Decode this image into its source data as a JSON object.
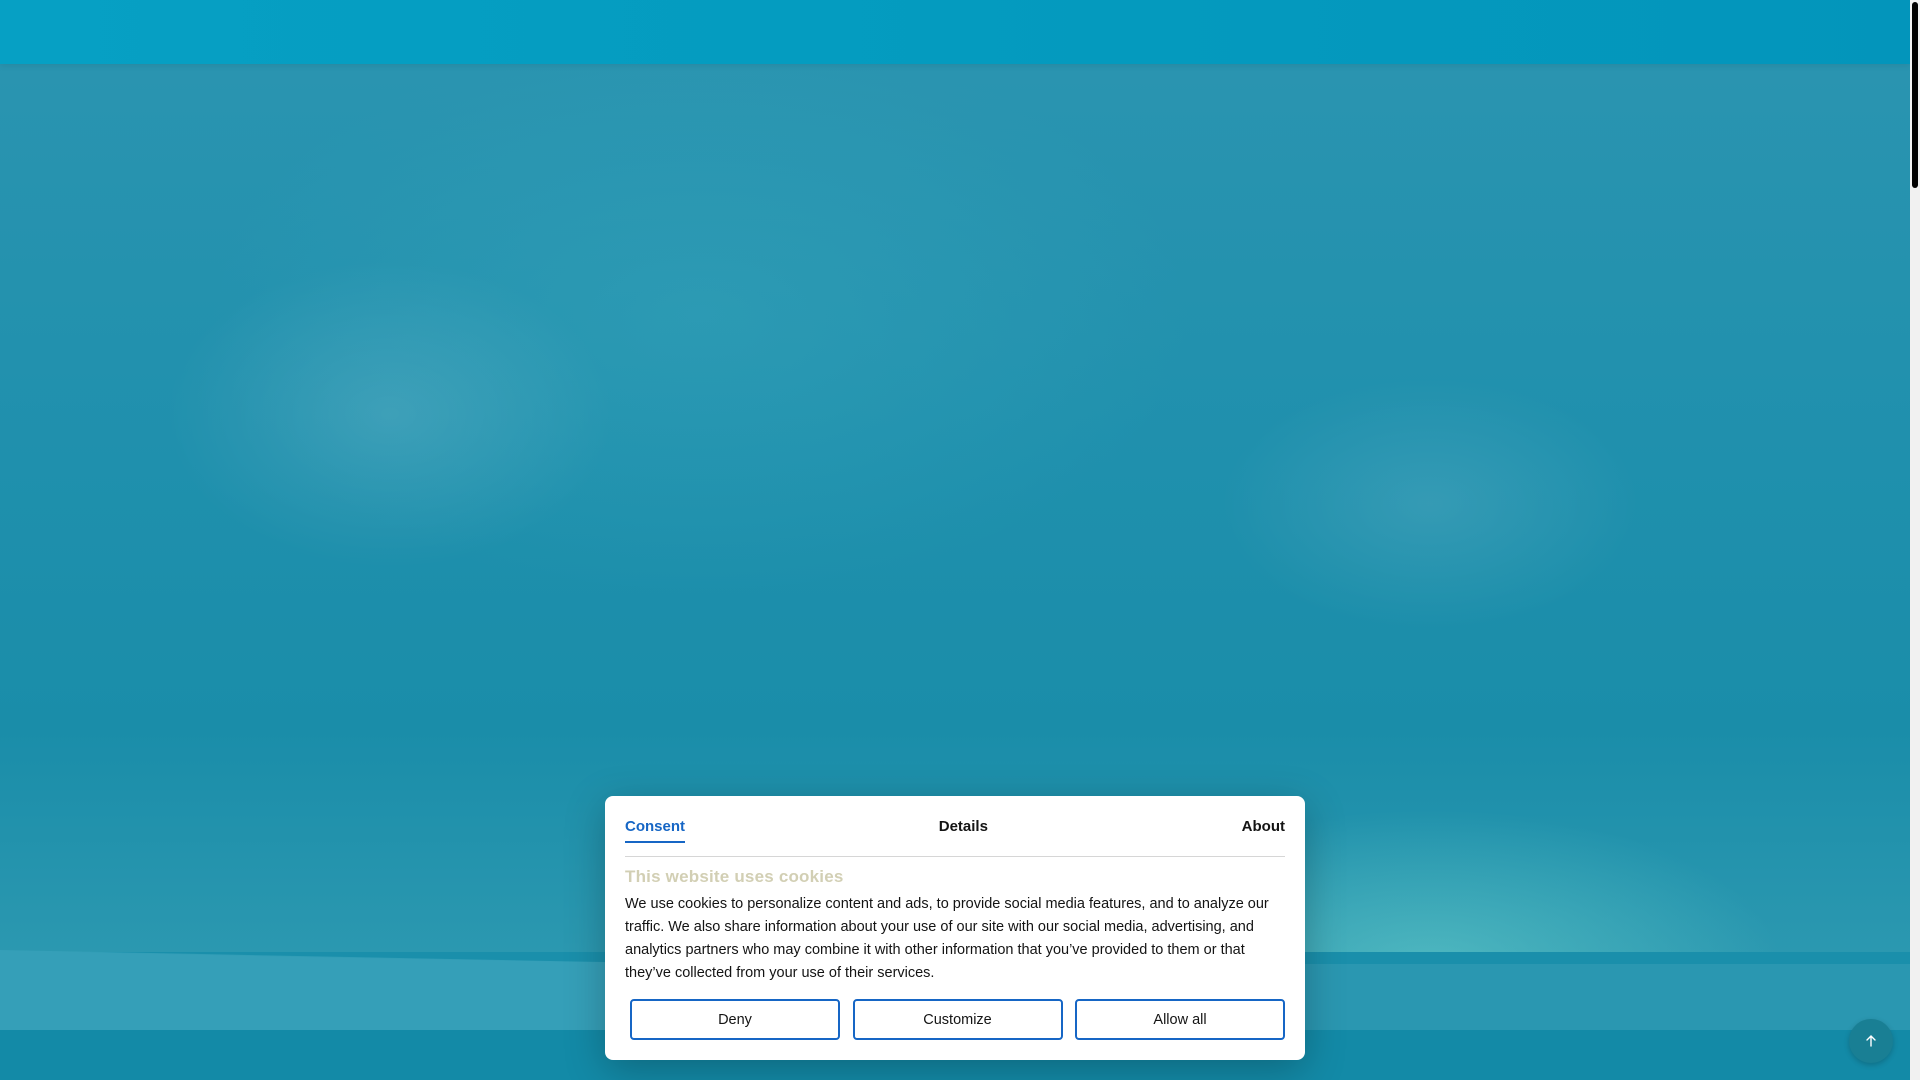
{
  "consent": {
    "tabs": [
      {
        "label": "Consent",
        "active": true
      },
      {
        "label": "Details",
        "active": false
      },
      {
        "label": "About",
        "active": false
      }
    ],
    "title": "This website uses cookies",
    "body": "We use cookies to personalize content and ads, to provide social media features, and to analyze our traffic. We also share information about your use of our site with our social media, advertising, and analytics partners who may combine it with other information that you’ve provided to them or that they’ve collected from your use of their services.",
    "buttons": {
      "deny": "Deny",
      "customize": "Customize",
      "allow_all": "Allow all"
    }
  },
  "back_to_top": {
    "icon": "arrow-up-icon"
  },
  "colors": {
    "accent": "#1666c5",
    "header": "#049bbf",
    "background": "#1a8fab",
    "title_muted": "#d2cfb4"
  }
}
